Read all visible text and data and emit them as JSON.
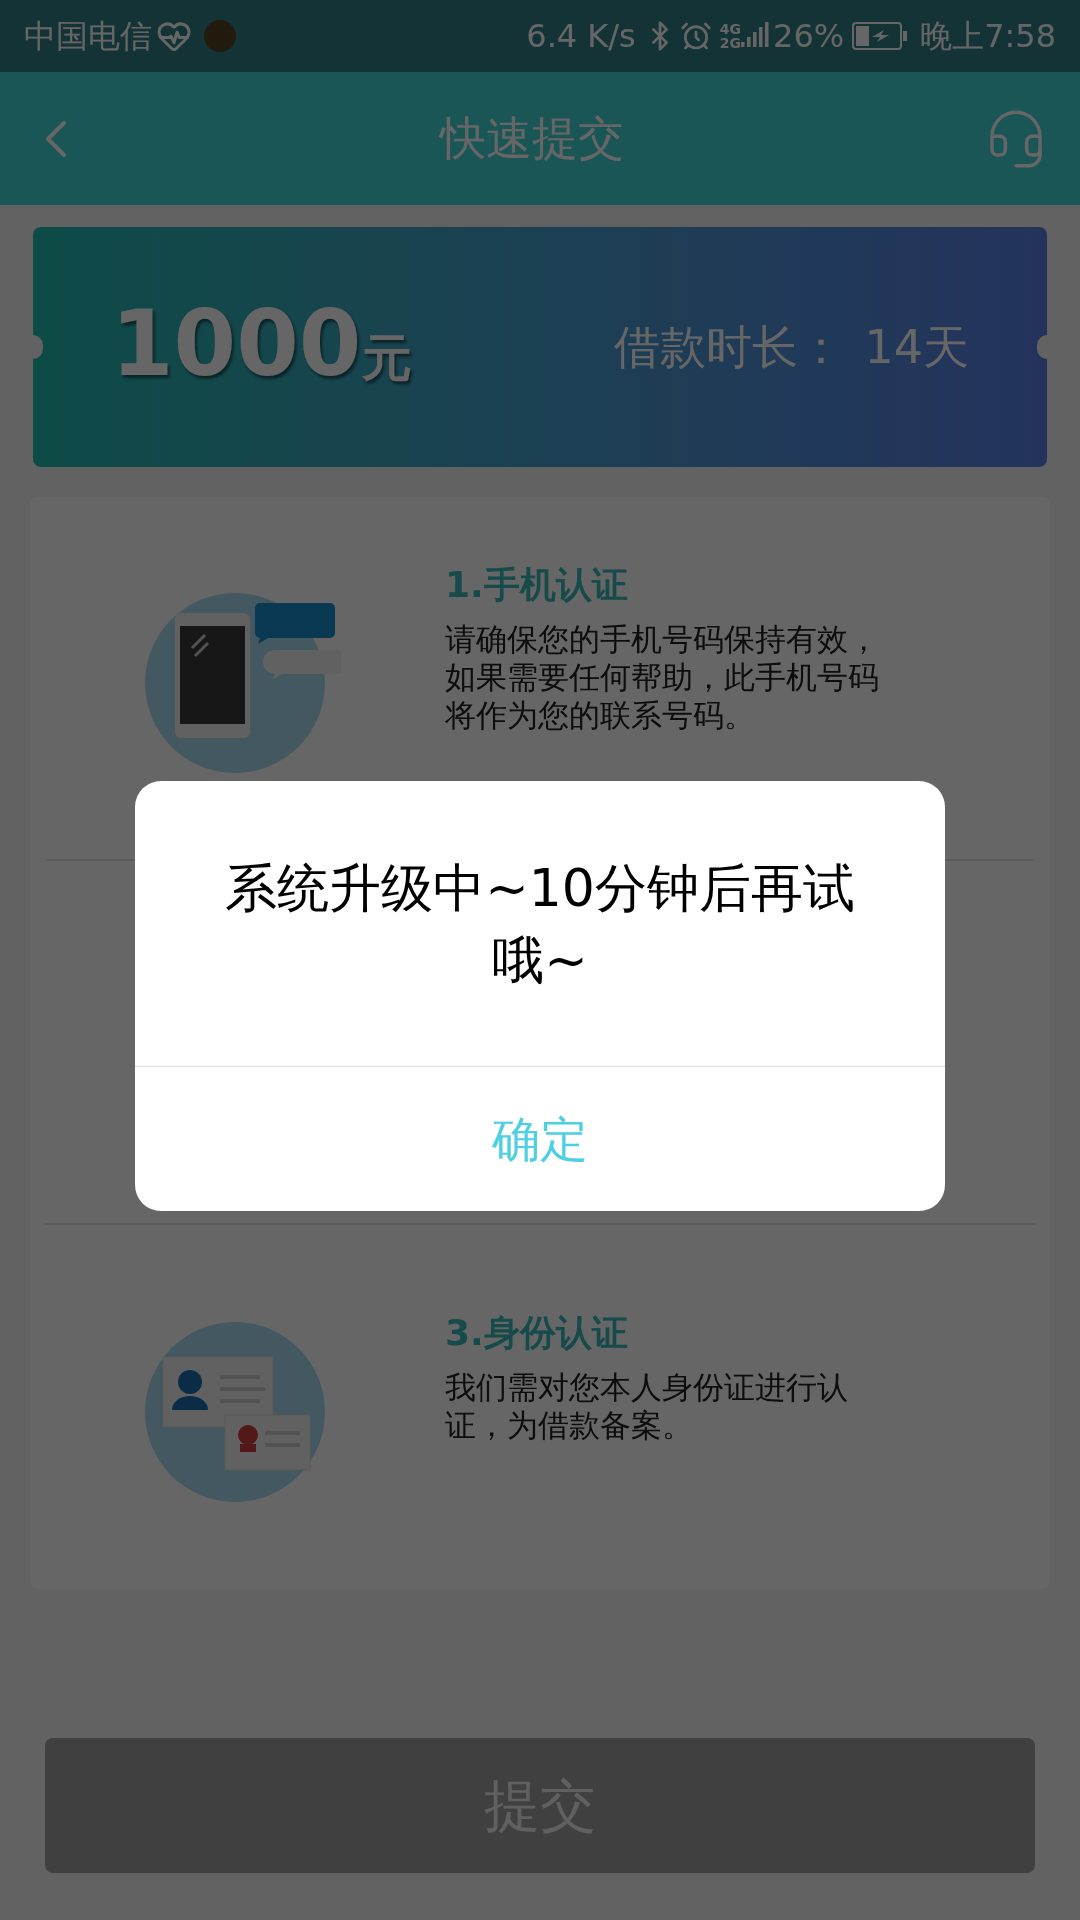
{
  "status_bar": {
    "carrier": "中国电信",
    "speed": "6.4 K/s",
    "network_top": "4G",
    "network_bottom": "2G",
    "battery": "26%",
    "time": "晚上7:58"
  },
  "header": {
    "title": "快速提交"
  },
  "loan_card": {
    "amount": "1000",
    "unit": "元",
    "term_label": "借款时长：",
    "term_value": "14天"
  },
  "steps": [
    {
      "kind": "phone",
      "title": "1.手机认证",
      "description": "请确保您的手机号码保持有效，如果需要任何帮助，此手机号码将作为您的联系号码。"
    },
    {
      "kind": "hidden"
    },
    {
      "kind": "id",
      "title": "3.身份认证",
      "description": "我们需对您本人身份证进行认证，为借款备案。"
    }
  ],
  "submit_button": {
    "label": "提交",
    "disabled": true
  },
  "dialog": {
    "message": "系统升级中~10分钟后再试哦~",
    "confirm": "确定"
  }
}
